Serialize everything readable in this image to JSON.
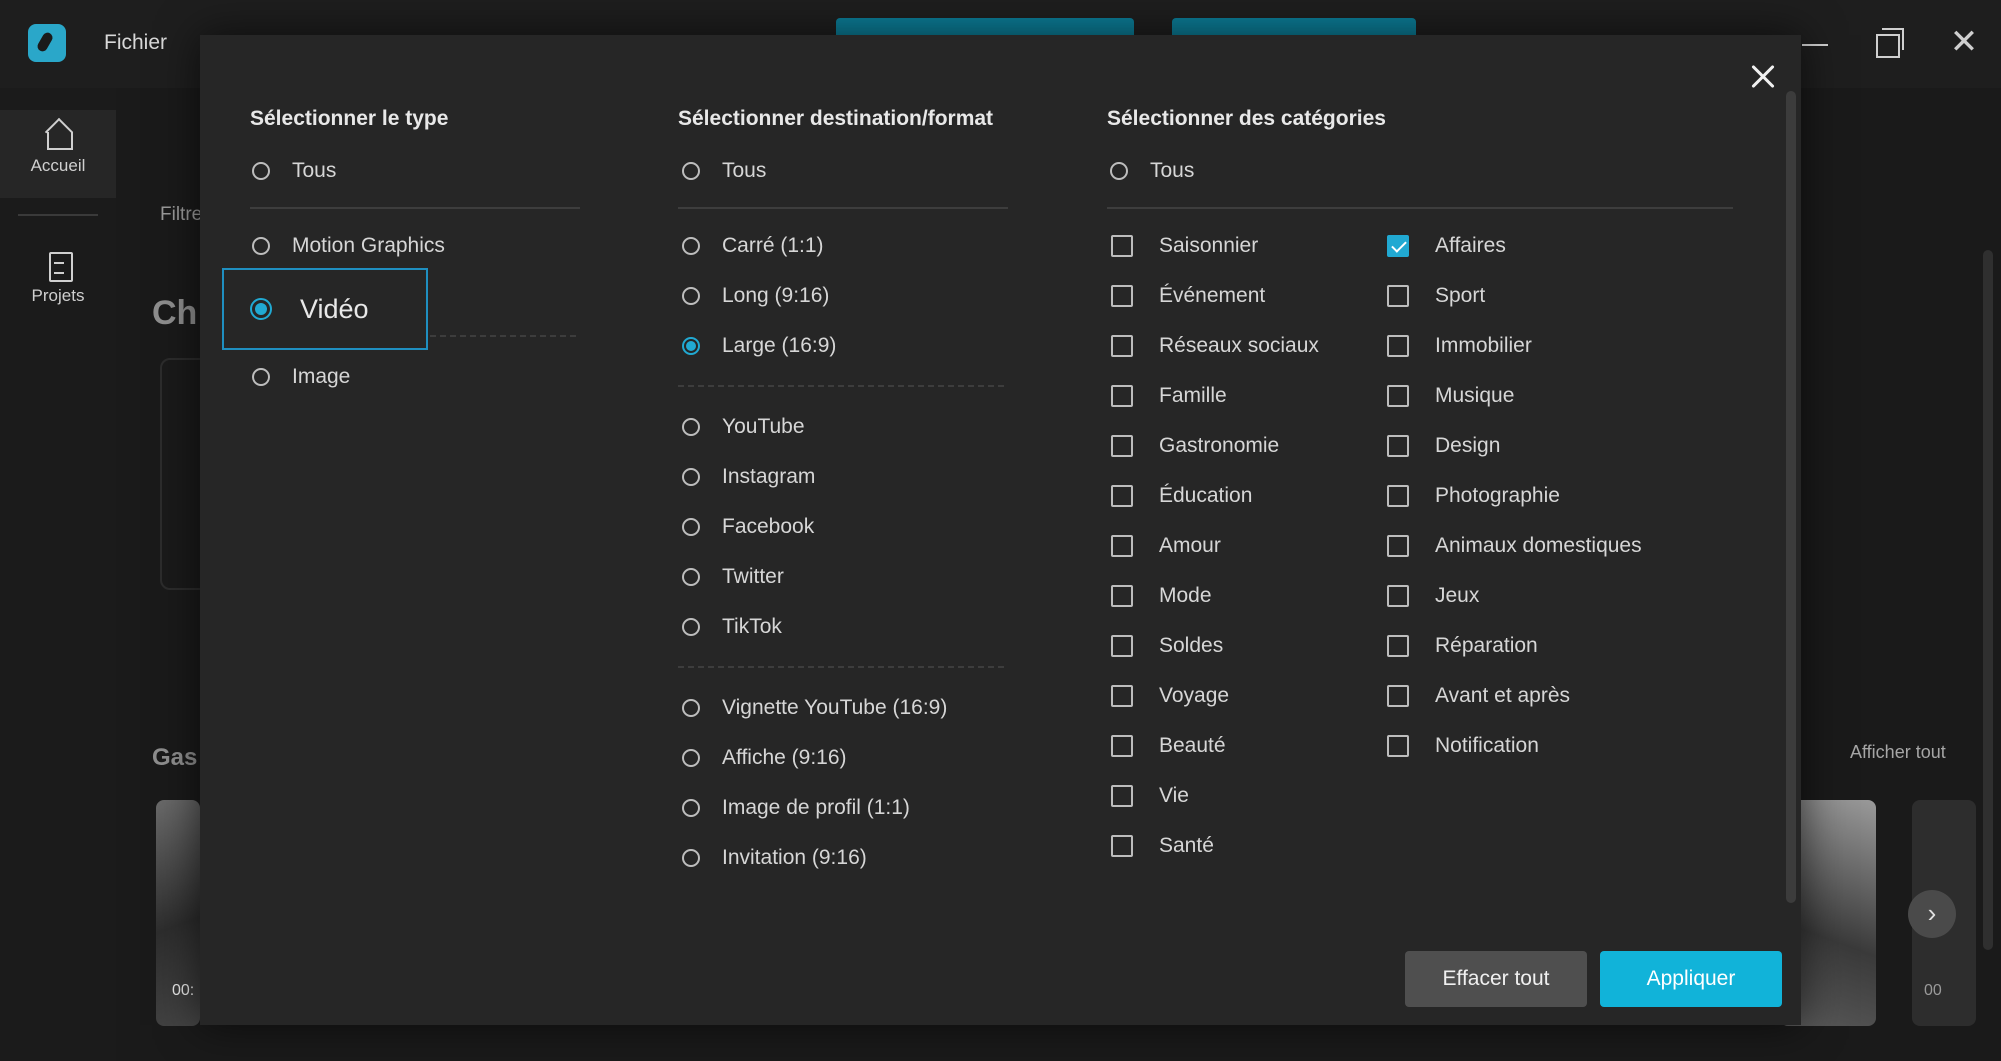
{
  "app": {
    "menu_file": "Fichier",
    "window_controls": [
      "minimize-icon",
      "maximize-icon",
      "close-icon"
    ]
  },
  "sidebar": {
    "items": [
      {
        "label": "Accueil",
        "icon": "home-icon",
        "active": true
      },
      {
        "label": "Projets",
        "icon": "document-icon",
        "active": false
      }
    ]
  },
  "background": {
    "filter_label": "Filtre",
    "heading": "Ch",
    "section_title": "Gas",
    "show_all": "Afficher tout",
    "thumb_time_left": "00:",
    "thumb_time_right": "00"
  },
  "modal": {
    "type": {
      "title": "Sélectionner le type",
      "options": [
        "Tous",
        "Motion Graphics",
        "Vidéo",
        "Image"
      ],
      "selected": "Vidéo"
    },
    "destination": {
      "title": "Sélectionner destination/format",
      "options": [
        "Tous",
        "Carré (1:1)",
        "Long (9:16)",
        "Large (16:9)",
        "YouTube",
        "Instagram",
        "Facebook",
        "Twitter",
        "TikTok",
        "Vignette YouTube (16:9)",
        "Affiche (9:16)",
        "Image de profil (1:1)",
        "Invitation (9:16)"
      ],
      "selected": "Large (16:9)"
    },
    "categories": {
      "title": "Sélectionner des catégories",
      "all_label": "Tous",
      "col1": [
        "Saisonnier",
        "Événement",
        "Réseaux sociaux",
        "Famille",
        "Gastronomie",
        "Éducation",
        "Amour",
        "Mode",
        "Soldes",
        "Voyage",
        "Beauté",
        "Vie",
        "Santé"
      ],
      "col2": [
        "Affaires",
        "Sport",
        "Immobilier",
        "Musique",
        "Design",
        "Photographie",
        "Animaux domestiques",
        "Jeux",
        "Réparation",
        "Avant et après",
        "Notification"
      ],
      "checked": [
        "Affaires"
      ]
    },
    "buttons": {
      "clear": "Effacer tout",
      "apply": "Appliquer"
    },
    "colors": {
      "accent": "#21a9d2",
      "apply_button": "#11b3d9",
      "modal_bg": "#262626"
    }
  }
}
